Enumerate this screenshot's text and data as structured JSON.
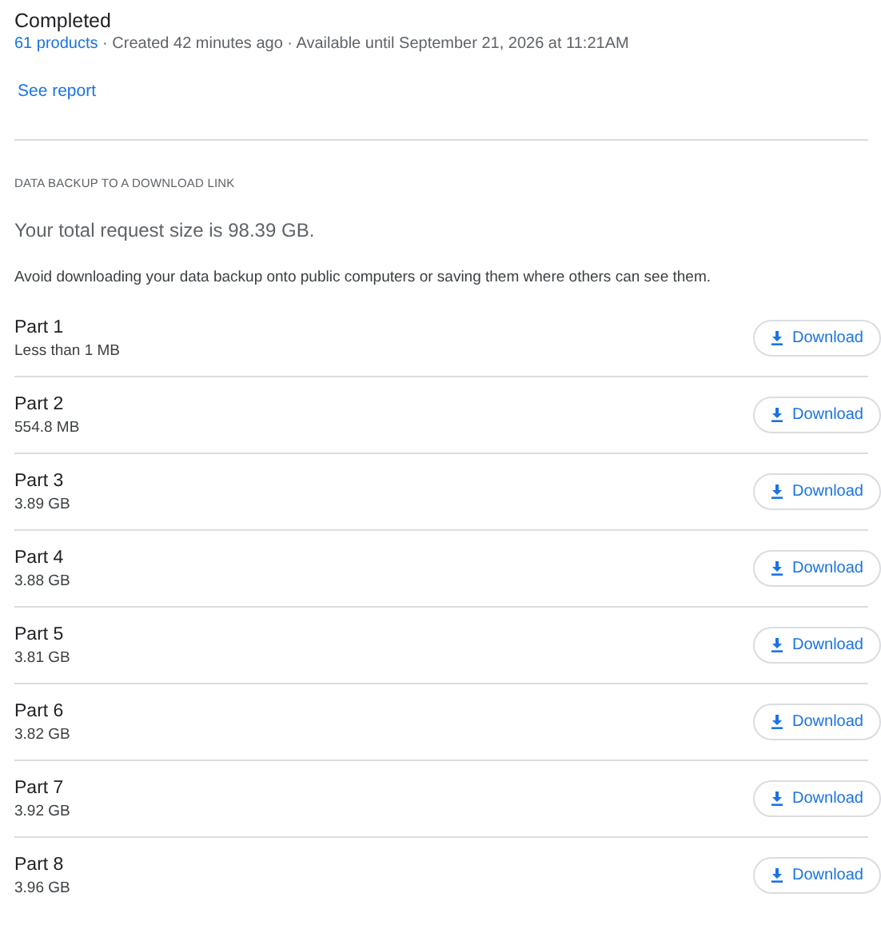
{
  "status": {
    "title": "Completed",
    "products_link": "61 products",
    "meta": " · Created 42 minutes ago · Available until September 21, 2026 at 11:21AM"
  },
  "report_link": "See report",
  "section": {
    "heading": "DATA BACKUP TO A DOWNLOAD LINK",
    "total": "Your total request size is 98.39 GB.",
    "warning": "Avoid downloading your data backup onto public computers or saving them where others can see them."
  },
  "parts": [
    {
      "name": "Part 1",
      "size": "Less than 1 MB",
      "button": "Download"
    },
    {
      "name": "Part 2",
      "size": "554.8 MB",
      "button": "Download"
    },
    {
      "name": "Part 3",
      "size": "3.89 GB",
      "button": "Download"
    },
    {
      "name": "Part 4",
      "size": "3.88 GB",
      "button": "Download"
    },
    {
      "name": "Part 5",
      "size": "3.81 GB",
      "button": "Download"
    },
    {
      "name": "Part 6",
      "size": "3.82 GB",
      "button": "Download"
    },
    {
      "name": "Part 7",
      "size": "3.92 GB",
      "button": "Download"
    },
    {
      "name": "Part 8",
      "size": "3.96 GB",
      "button": "Download"
    }
  ]
}
